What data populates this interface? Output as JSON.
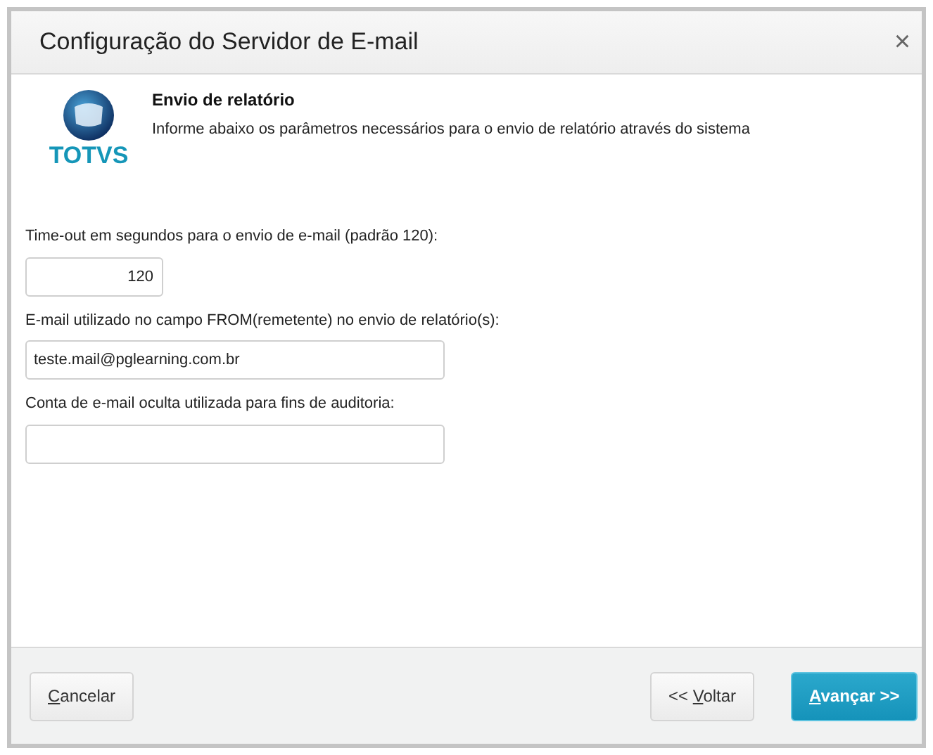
{
  "window": {
    "title": "Configuração do Servidor de E-mail",
    "close": "×"
  },
  "logo": {
    "text": "TOTVS"
  },
  "section": {
    "title": "Envio de relatório",
    "description": "Informe abaixo os parâmetros necessários para o envio de relatório através do sistema"
  },
  "fields": [
    {
      "label": "Time-out em segundos para o envio de e-mail (padrão 120):",
      "value": "120",
      "kind": "number"
    },
    {
      "label": "E-mail utilizado no campo FROM(remetente) no envio de relatório(s):",
      "value": "teste.mail@pglearning.com.br",
      "kind": "text"
    },
    {
      "label": "Conta de e-mail oculta utilizada para fins de auditoria:",
      "kind": "text"
    }
  ],
  "buttons": [
    {
      "key": "C",
      "rest": "ancelar",
      "kind": "default"
    },
    {
      "prefix": "<< ",
      "key": "V",
      "rest": "oltar",
      "kind": "default"
    },
    {
      "key": "A",
      "rest": "vançar >>",
      "kind": "primary"
    }
  ]
}
